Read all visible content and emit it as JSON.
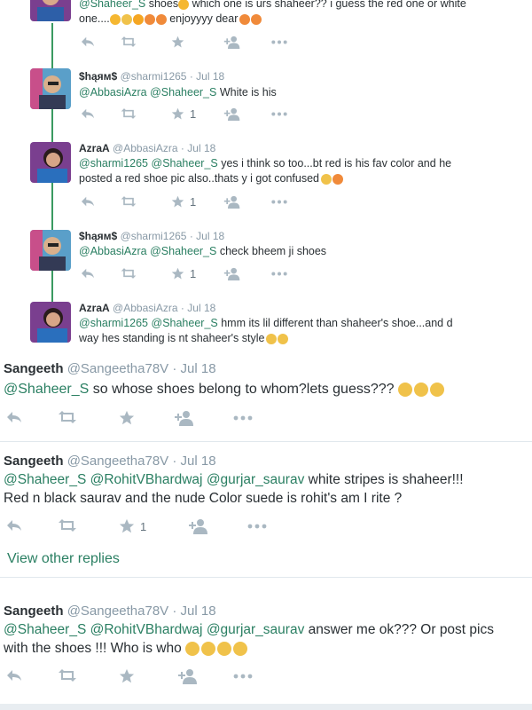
{
  "tweets": [
    {
      "text_pre": "which one is urs shaheer?? i guess the red one or white one....",
      "mention1": "@Shaheer_S",
      "word_shoes": "shoes",
      "text_end": "enjoyyyy dear"
    },
    {
      "name": "$hąям$",
      "handle": "@sharmi1265",
      "date": "Jul 18",
      "mentions": [
        "@AbbasiAzra",
        "@Shaheer_S"
      ],
      "text": "White is his",
      "likes": "1"
    },
    {
      "name": "AzraA",
      "handle": "@AbbasiAzra",
      "date": "Jul 18",
      "mentions": [
        "@sharmi1265",
        "@Shaheer_S"
      ],
      "text1": "yes i think so too...bt red is his fav color and he",
      "text2": "posted a red shoe pic also..thats y i got confused",
      "likes": "1"
    },
    {
      "name": "$hąям$",
      "handle": "@sharmi1265",
      "date": "Jul 18",
      "mentions": [
        "@AbbasiAzra",
        "@Shaheer_S"
      ],
      "text": "check bheem ji shoes",
      "likes": "1"
    },
    {
      "name": "AzraA",
      "handle": "@AbbasiAzra",
      "date": "Jul 18",
      "mentions": [
        "@sharmi1265",
        "@Shaheer_S"
      ],
      "text1": "hmm its lil different than shaheer's shoe...and d",
      "text2": "way hes standing is nt shaheer's style"
    },
    {
      "name": "Sangeeth",
      "handle": "@Sangeetha78V",
      "date": "Jul 18",
      "mentions": [
        "@Shaheer_S"
      ],
      "text": "so whose shoes belong to whom?lets guess???"
    },
    {
      "name": "Sangeeth",
      "handle": "@Sangeetha78V",
      "date": "Jul 18",
      "mentions": [
        "@Shaheer_S",
        "@RohitVBhardwaj",
        "@gurjar_saurav"
      ],
      "text1": "white stripes is shaheer!!!",
      "text2": "Red n black saurav and the nude Color suede is rohit's am I rite ?",
      "likes": "1"
    },
    {
      "name": "Sangeeth",
      "handle": "@Sangeetha78V",
      "date": "Jul 18",
      "mentions": [
        "@Shaheer_S",
        "@RohitVBhardwaj",
        "@gurjar_saurav"
      ],
      "text1": "answer me ok??? Or post pics",
      "text2": "with the shoes !!! Who is who"
    }
  ],
  "view_other_replies": "View other replies",
  "dot": "·",
  "colors": {
    "mention": "#2a7f62",
    "thread_line": "#3a9a61",
    "muted": "#8899a6",
    "icon": "#aab8c2"
  },
  "icons": [
    "reply-icon",
    "retweet-icon",
    "like-icon",
    "follow-icon",
    "more-icon"
  ]
}
